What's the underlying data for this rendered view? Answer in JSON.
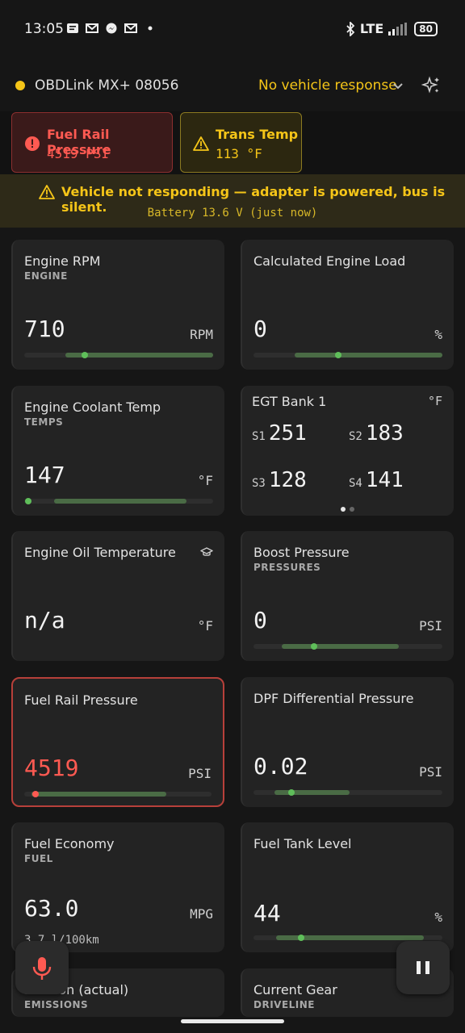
{
  "status_bar": {
    "time": "13:05",
    "network": "LTE",
    "battery": "80"
  },
  "header": {
    "adapter": "OBDLink MX+ 08056",
    "vehicle_status": "No vehicle response",
    "status_color": "#f5c518"
  },
  "alerts": [
    {
      "title": "Fuel Rail Pressure",
      "value": "4519 PSI",
      "level": "error"
    },
    {
      "title": "Trans Temp",
      "value": "113 °F",
      "level": "warning"
    }
  ],
  "banner": {
    "message": "Vehicle not responding — adapter is powered, bus is silent.",
    "detail": "Battery 13.6 V (just now)"
  },
  "cards": {
    "engine_rpm": {
      "title": "Engine RPM",
      "category": "ENGINE",
      "value": "710",
      "unit": "RPM"
    },
    "engine_load": {
      "title": "Calculated Engine Load",
      "value": "0",
      "unit": "%"
    },
    "coolant": {
      "title": "Engine Coolant Temp",
      "category": "TEMPS",
      "value": "147",
      "unit": "°F"
    },
    "egt": {
      "title": "EGT Bank 1",
      "unit": "°F",
      "sensors": [
        {
          "label": "S1",
          "value": "251"
        },
        {
          "label": "S2",
          "value": "183"
        },
        {
          "label": "S3",
          "value": "128"
        },
        {
          "label": "S4",
          "value": "141"
        }
      ]
    },
    "oil_temp": {
      "title": "Engine Oil Temperature",
      "value": "n/a",
      "unit": "°F"
    },
    "boost": {
      "title": "Boost Pressure",
      "category": "PRESSURES",
      "value": "0",
      "unit": "PSI"
    },
    "fuel_rail": {
      "title": "Fuel Rail Pressure",
      "value": "4519",
      "unit": "PSI"
    },
    "dpf": {
      "title": "DPF Differential Pressure",
      "value": "0.02",
      "unit": "PSI"
    },
    "fuel_economy": {
      "title": "Fuel Economy",
      "category": "FUEL",
      "value": "63.0",
      "unit": "MPG",
      "secondary": "3.7 l/100km"
    },
    "fuel_tank": {
      "title": "Fuel Tank Level",
      "value": "44",
      "unit": "%"
    },
    "egr": {
      "title": "Position (actual)",
      "category": "EMISSIONS"
    },
    "gear": {
      "title": "Current Gear",
      "category": "DRIVELINE"
    }
  },
  "gauges": {
    "engine_rpm": {
      "level": 0.32
    },
    "engine_load": {
      "level": 0.45
    },
    "coolant": {
      "level": 0.02
    },
    "boost": {
      "level": 0.32
    },
    "fuel_rail": {
      "level": 0.06
    },
    "dpf": {
      "level": 0.2
    },
    "fuel_tank": {
      "level": 0.25
    }
  },
  "icons": {
    "alert_error": "error-circle-icon",
    "alert_warning": "warning-triangle-icon",
    "learn": "graduation-cap-icon",
    "mic": "microphone-icon",
    "pause": "pause-icon",
    "ai": "sparkle-icon"
  }
}
